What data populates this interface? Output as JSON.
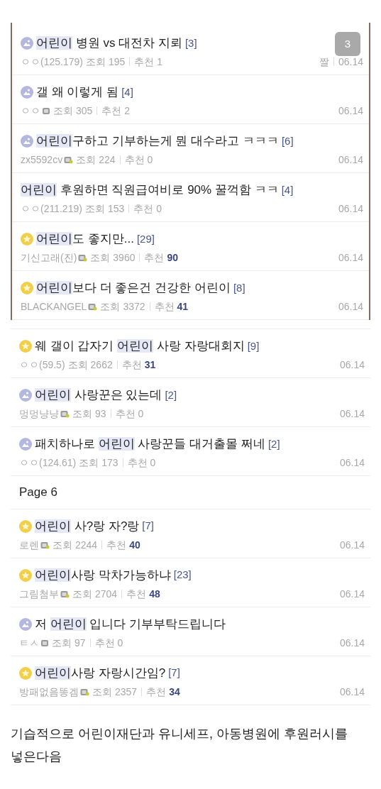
{
  "framed_posts": [
    {
      "kind": "image",
      "title": [
        {
          "text": "어린이",
          "highlight": true
        },
        {
          "text": " 병원 vs 대전차 지뢰",
          "highlight": false
        }
      ],
      "comments": "[3]",
      "author": "ㅇㅇ(125.179)",
      "stats": [
        {
          "label": "조회",
          "value": "195"
        },
        {
          "label": "추천",
          "value": "1"
        }
      ],
      "tag": "짤",
      "date": "06.14",
      "page_badge": "3"
    },
    {
      "kind": "image",
      "title": [
        {
          "text": "갤 왜 이렇게 됨",
          "highlight": false
        }
      ],
      "comments": "[4]",
      "author": "ㅇㅇ",
      "badge": {
        "kind": "fixed"
      },
      "stats": [
        {
          "label": "조회",
          "value": "305"
        },
        {
          "label": "추천",
          "value": "2"
        }
      ],
      "date": "06.14"
    },
    {
      "kind": "image",
      "title": [
        {
          "text": "어린이",
          "highlight": true
        },
        {
          "text": "구하고 기부하는게 뭔 대수라고 ㅋㅋㅋ",
          "highlight": false
        }
      ],
      "comments": "[6]",
      "author": "zx5592cv",
      "badge": {
        "kind": "semi"
      },
      "stats": [
        {
          "label": "조회",
          "value": "224"
        },
        {
          "label": "추천",
          "value": "0"
        }
      ],
      "date": "06.14"
    },
    {
      "kind": "plain",
      "title": [
        {
          "text": "어린이",
          "highlight": true
        },
        {
          "text": " 후원하면 직원급여비로 90% 꿀꺽함 ㅋㅋ",
          "highlight": false
        }
      ],
      "comments": "[4]",
      "author": "ㅇㅇ(211.219)",
      "stats": [
        {
          "label": "조회",
          "value": "153"
        },
        {
          "label": "추천",
          "value": "0"
        }
      ],
      "date": "06.14"
    },
    {
      "kind": "star",
      "title": [
        {
          "text": "어린이",
          "highlight": true
        },
        {
          "text": "도 좋지만...",
          "highlight": false
        }
      ],
      "comments": "[29]",
      "author": "기신고래(진)",
      "badge": {
        "kind": "semi"
      },
      "stats": [
        {
          "label": "조회",
          "value": "3960"
        },
        {
          "label": "추천",
          "value": "90"
        }
      ],
      "date": "06.14"
    },
    {
      "kind": "star",
      "title": [
        {
          "text": "어린이",
          "highlight": true
        },
        {
          "text": "보다 더 좋은건 건강한 어린이",
          "highlight": false
        }
      ],
      "comments": "[8]",
      "author": "BLACKANGEL",
      "badge": {
        "kind": "semi"
      },
      "stats": [
        {
          "label": "조회",
          "value": "3372"
        },
        {
          "label": "추천",
          "value": "41"
        }
      ],
      "date": "06.14"
    }
  ],
  "posts": [
    {
      "kind": "star",
      "title": [
        {
          "text": "웨 갤이 갑자기 ",
          "highlight": false
        },
        {
          "text": "어린이",
          "highlight": true
        },
        {
          "text": " 사랑 자랑대회지",
          "highlight": false
        }
      ],
      "comments": "[9]",
      "author": "ㅇㅇ(59.5)",
      "stats": [
        {
          "label": "조회",
          "value": "2662"
        },
        {
          "label": "추천",
          "value": "31"
        }
      ],
      "date": "06.14"
    },
    {
      "kind": "image",
      "title": [
        {
          "text": "어린이",
          "highlight": true
        },
        {
          "text": " 사랑꾼은 있는데",
          "highlight": false
        }
      ],
      "comments": "[2]",
      "author": "멍멍냥냥",
      "badge": {
        "kind": "semi"
      },
      "stats": [
        {
          "label": "조회",
          "value": "93"
        },
        {
          "label": "추천",
          "value": "0"
        }
      ],
      "date": "06.14"
    },
    {
      "kind": "image",
      "title": [
        {
          "text": "패치하나로 ",
          "highlight": false
        },
        {
          "text": "어린이",
          "highlight": true
        },
        {
          "text": " 사랑꾼들 대거출몰 쩌네",
          "highlight": false
        }
      ],
      "comments": "[2]",
      "author": "ㅇㅇ(124.61)",
      "stats": [
        {
          "label": "조회",
          "value": "173"
        },
        {
          "label": "추천",
          "value": "0"
        }
      ],
      "date": "06.14"
    }
  ],
  "page_label": "Page 6",
  "page_posts": [
    {
      "kind": "star",
      "title": [
        {
          "text": "어린이",
          "highlight": true
        },
        {
          "text": " 사?랑 자?랑",
          "highlight": false
        }
      ],
      "comments": "[7]",
      "author": "로렌",
      "badge": {
        "kind": "semi"
      },
      "stats": [
        {
          "label": "조회",
          "value": "2244"
        },
        {
          "label": "추천",
          "value": "40"
        }
      ],
      "date": "06.14"
    },
    {
      "kind": "star",
      "title": [
        {
          "text": "어린이",
          "highlight": true
        },
        {
          "text": "사랑 막차가능하냐",
          "highlight": false
        }
      ],
      "comments": "[23]",
      "author": "그림첨부",
      "badge": {
        "kind": "semi"
      },
      "stats": [
        {
          "label": "조회",
          "value": "2704"
        },
        {
          "label": "추천",
          "value": "48"
        }
      ],
      "date": "06.14"
    },
    {
      "kind": "image",
      "title": [
        {
          "text": "저 ",
          "highlight": false
        },
        {
          "text": "어린이",
          "highlight": true
        },
        {
          "text": " 입니다 기부부탁드립니다",
          "highlight": false
        }
      ],
      "author": "ㅌㅅ",
      "badge": {
        "kind": "fixed"
      },
      "stats": [
        {
          "label": "조회",
          "value": "97"
        },
        {
          "label": "추천",
          "value": "0"
        }
      ],
      "date": "06.14"
    },
    {
      "kind": "star",
      "title": [
        {
          "text": "어린이",
          "highlight": true
        },
        {
          "text": "사랑 자랑시간임?",
          "highlight": false
        }
      ],
      "comments": "[7]",
      "author": "방패없음똥겜",
      "badge": {
        "kind": "semi"
      },
      "stats": [
        {
          "label": "조회",
          "value": "2357"
        },
        {
          "label": "추천",
          "value": "34"
        }
      ],
      "date": "06.14"
    }
  ],
  "caption": "기습적으로 어린이재단과 유니세프, 아동병원에 후원러시를 넣은다음"
}
